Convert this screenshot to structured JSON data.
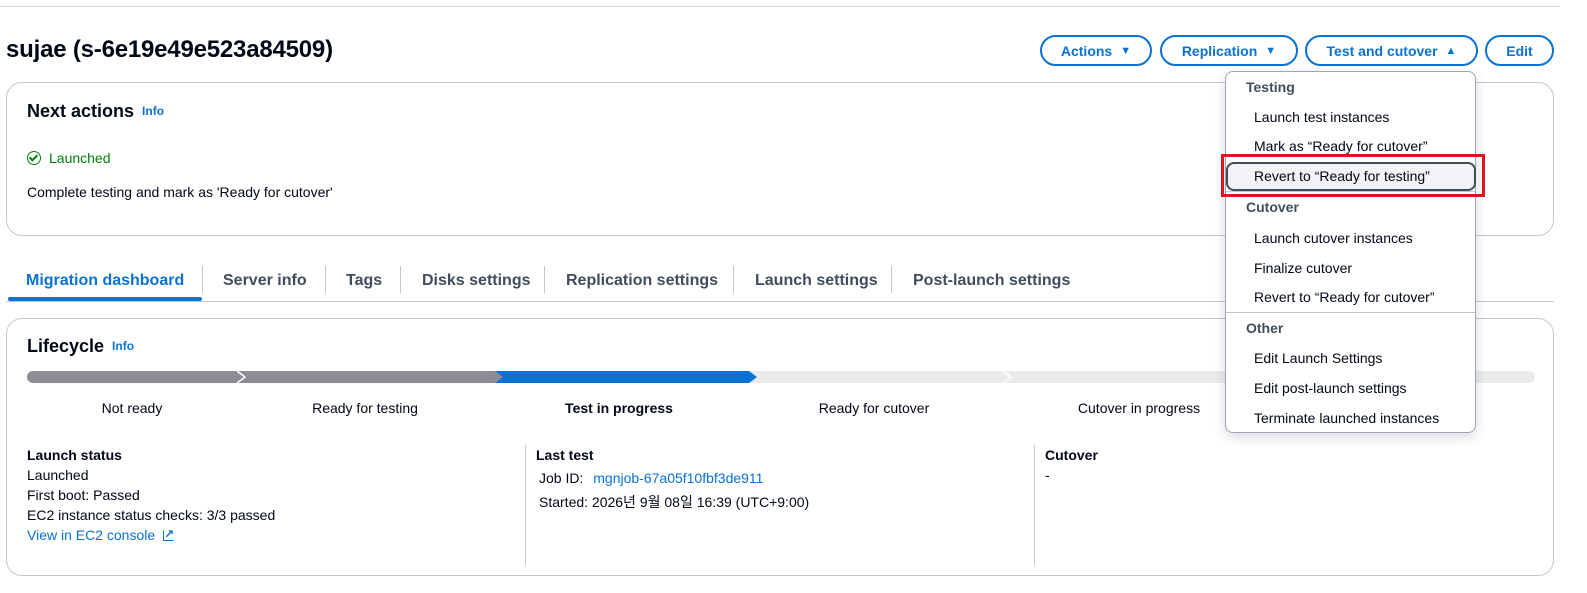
{
  "header": {
    "title": "sujae (s-6e19e49e523a84509)",
    "buttons": {
      "actions": "Actions",
      "replication": "Replication",
      "test_cutover": "Test and cutover",
      "edit": "Edit"
    },
    "icons": {
      "caret_down": "▼",
      "caret_up": "▲"
    }
  },
  "next_actions": {
    "title": "Next actions",
    "info": "Info",
    "status": "Launched",
    "description": "Complete testing and mark as 'Ready for cutover'"
  },
  "tabs": [
    {
      "label": "Migration dashboard",
      "active": true
    },
    {
      "label": "Server info"
    },
    {
      "label": "Tags"
    },
    {
      "label": "Disks settings"
    },
    {
      "label": "Replication settings"
    },
    {
      "label": "Launch settings"
    },
    {
      "label": "Post-launch settings"
    }
  ],
  "lifecycle": {
    "title": "Lifecycle",
    "info": "Info",
    "steps": [
      "Not ready",
      "Ready for testing",
      "Test in progress",
      "Ready for cutover",
      "Cutover in progress"
    ],
    "current_step": "Test in progress",
    "colors": {
      "completed": "#8c8c94",
      "current": "#0972d3",
      "pending": "#e9ebed"
    }
  },
  "launch_status": {
    "heading": "Launch status",
    "lines": [
      "Launched",
      "First boot: Passed",
      "EC2 instance status checks: 3/3 passed"
    ],
    "link": "View in EC2 console"
  },
  "last_test": {
    "heading": "Last test",
    "job_label": "Job ID:",
    "job_id": "mgnjob-67a05f10fbf3de911",
    "started": "Started: 2026년 9월 08일 16:39 (UTC+9:00)"
  },
  "cutover": {
    "heading": "Cutover",
    "value": "-"
  },
  "dropdown": {
    "groups": [
      {
        "label": "Testing",
        "items": [
          "Launch test instances",
          "Mark as “Ready for cutover”",
          "Revert to “Ready for testing”"
        ]
      },
      {
        "label": "Cutover",
        "items": [
          "Launch cutover instances",
          "Finalize cutover",
          "Revert to “Ready for cutover”"
        ]
      },
      {
        "label": "Other",
        "items": [
          "Edit Launch Settings",
          "Edit post-launch settings",
          "Terminate launched instances"
        ]
      }
    ],
    "highlighted_item": "Revert to “Ready for testing”",
    "highlight_color": "#e1131f"
  }
}
